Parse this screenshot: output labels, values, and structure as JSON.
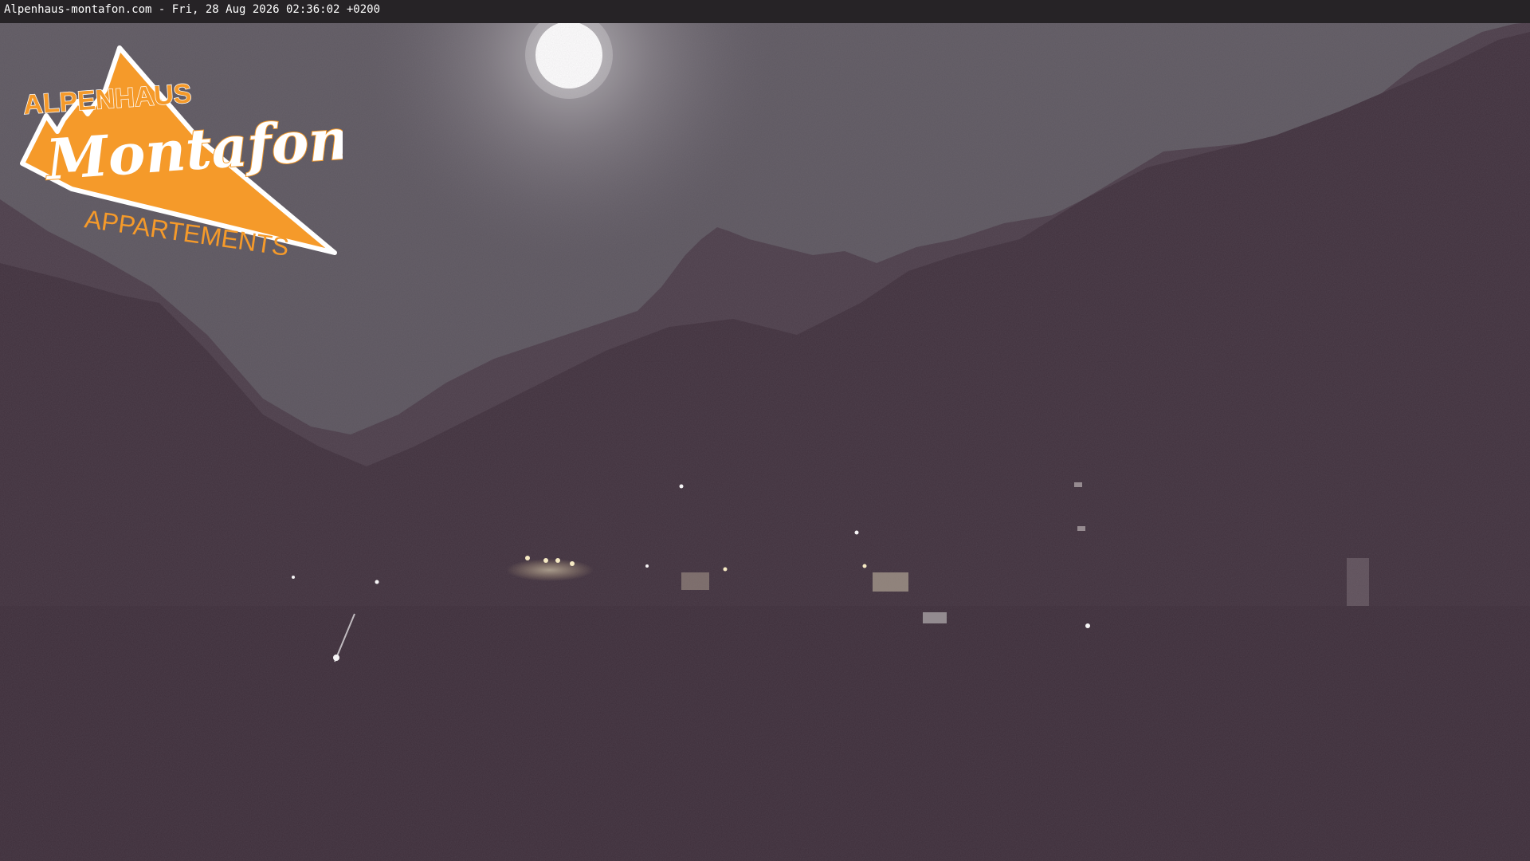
{
  "caption": {
    "text": "Alpenhaus-montafon.com - Fri, 28 Aug 2026 02:36:02 +0200"
  },
  "logo": {
    "line1": "ALPENHAUS",
    "line2": "Montafon",
    "line3": "APPARTEMENTS",
    "color": "#f59a2a"
  },
  "scene": {
    "sky_color": "#5b535d",
    "mountain_far_color": "#4a3c48",
    "mountain_near_color": "#3d2e39",
    "moon_color": "#ffffff",
    "light_color": "#ffe9b0"
  }
}
